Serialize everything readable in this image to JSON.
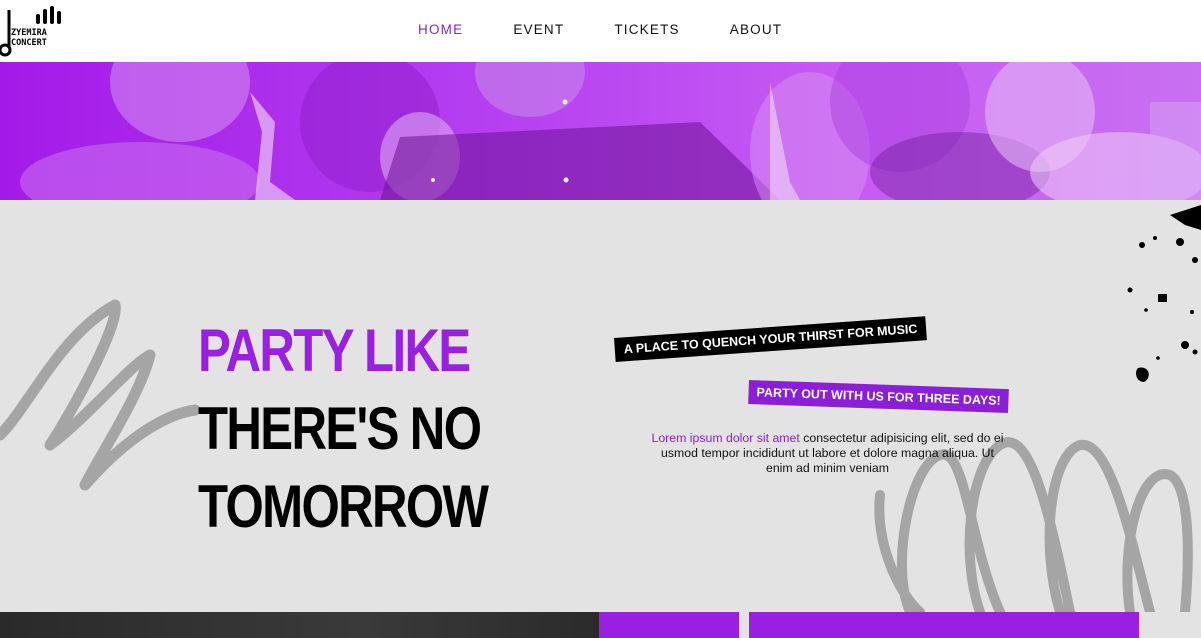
{
  "brand": {
    "line1": "ZYEMIRA",
    "line2": "CONCERT"
  },
  "nav": {
    "items": [
      {
        "label": "HOME",
        "active": true
      },
      {
        "label": "EVENT",
        "active": false
      },
      {
        "label": "TICKETS",
        "active": false
      },
      {
        "label": "ABOUT",
        "active": false
      }
    ]
  },
  "hero": {
    "headline": [
      "PARTY LIKE",
      "THERE'S NO",
      "TOMORROW"
    ]
  },
  "info": {
    "tag_primary": "A PLACE TO QUENCH YOUR THIRST FOR MUSIC",
    "tag_secondary": "PARTY OUT WITH US FOR THREE DAYS!",
    "body_highlight": "Lorem ipsum dolor sit amet",
    "body_rest": " consectetur adipisicing elit, sed do ei usmod tempor incididunt ut labore et dolore magna aliqua. Ut enim ad minim veniam"
  },
  "colors": {
    "accent": "#9b1fe2",
    "background": "#e3e3e3",
    "text": "#000000"
  }
}
